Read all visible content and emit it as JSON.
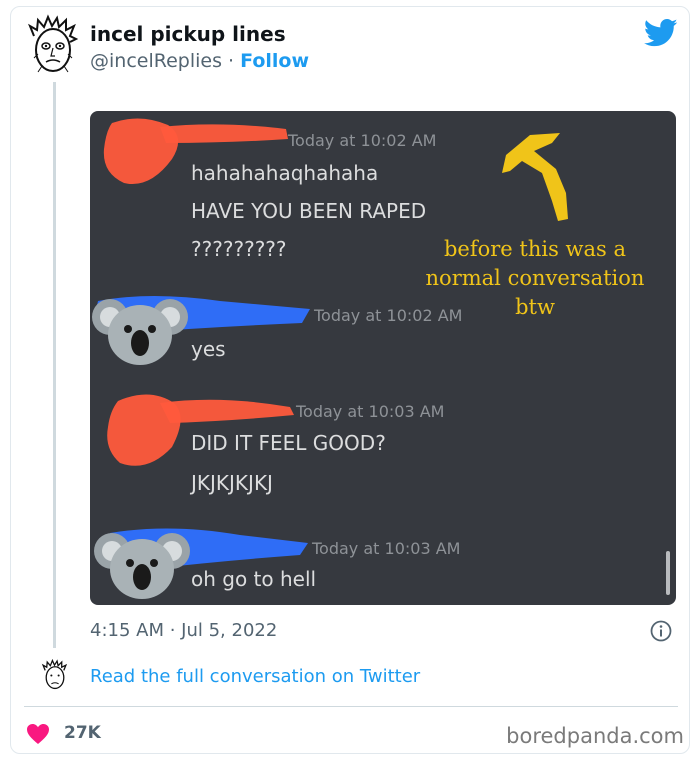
{
  "author": {
    "name": "incel pickup lines",
    "handle": "@incelReplies",
    "separator": "·",
    "follow_label": "Follow"
  },
  "screenshot": {
    "messages": [
      {
        "timestamp": "Today at 10:02 AM",
        "lines": [
          "hahahahaqhahaha",
          "HAVE YOU BEEN RAPED",
          "?????????"
        ],
        "avatar_scribble_color": "#ff5a3c"
      },
      {
        "timestamp": "Today at 10:02 AM",
        "lines": [
          "yes"
        ],
        "avatar": "koala-emoji",
        "name_scribble_color": "#2f6df6"
      },
      {
        "timestamp": "Today at 10:03 AM",
        "lines": [
          "DID IT FEEL GOOD?",
          "JKJKJKJKJ"
        ],
        "avatar_scribble_color": "#ff5a3c"
      },
      {
        "timestamp": "Today at 10:03 AM",
        "lines": [
          "oh go to hell"
        ],
        "avatar": "koala-emoji",
        "name_scribble_color": "#2f6df6"
      }
    ],
    "annotation": {
      "lines": [
        "before this was a",
        "normal conversation",
        "btw"
      ],
      "color": "#f0c419"
    },
    "background_color": "#36393f"
  },
  "tweet": {
    "time": "4:15 AM · Jul 5, 2022",
    "read_more": "Read the full conversation on Twitter",
    "likes": "27K"
  },
  "watermark": "boredpanda.com",
  "icons": [
    "twitter-bird-icon",
    "info-icon",
    "heart-icon"
  ],
  "colors": {
    "accent": "#1d9bf0",
    "heart": "#f91880",
    "muted": "#536471"
  }
}
